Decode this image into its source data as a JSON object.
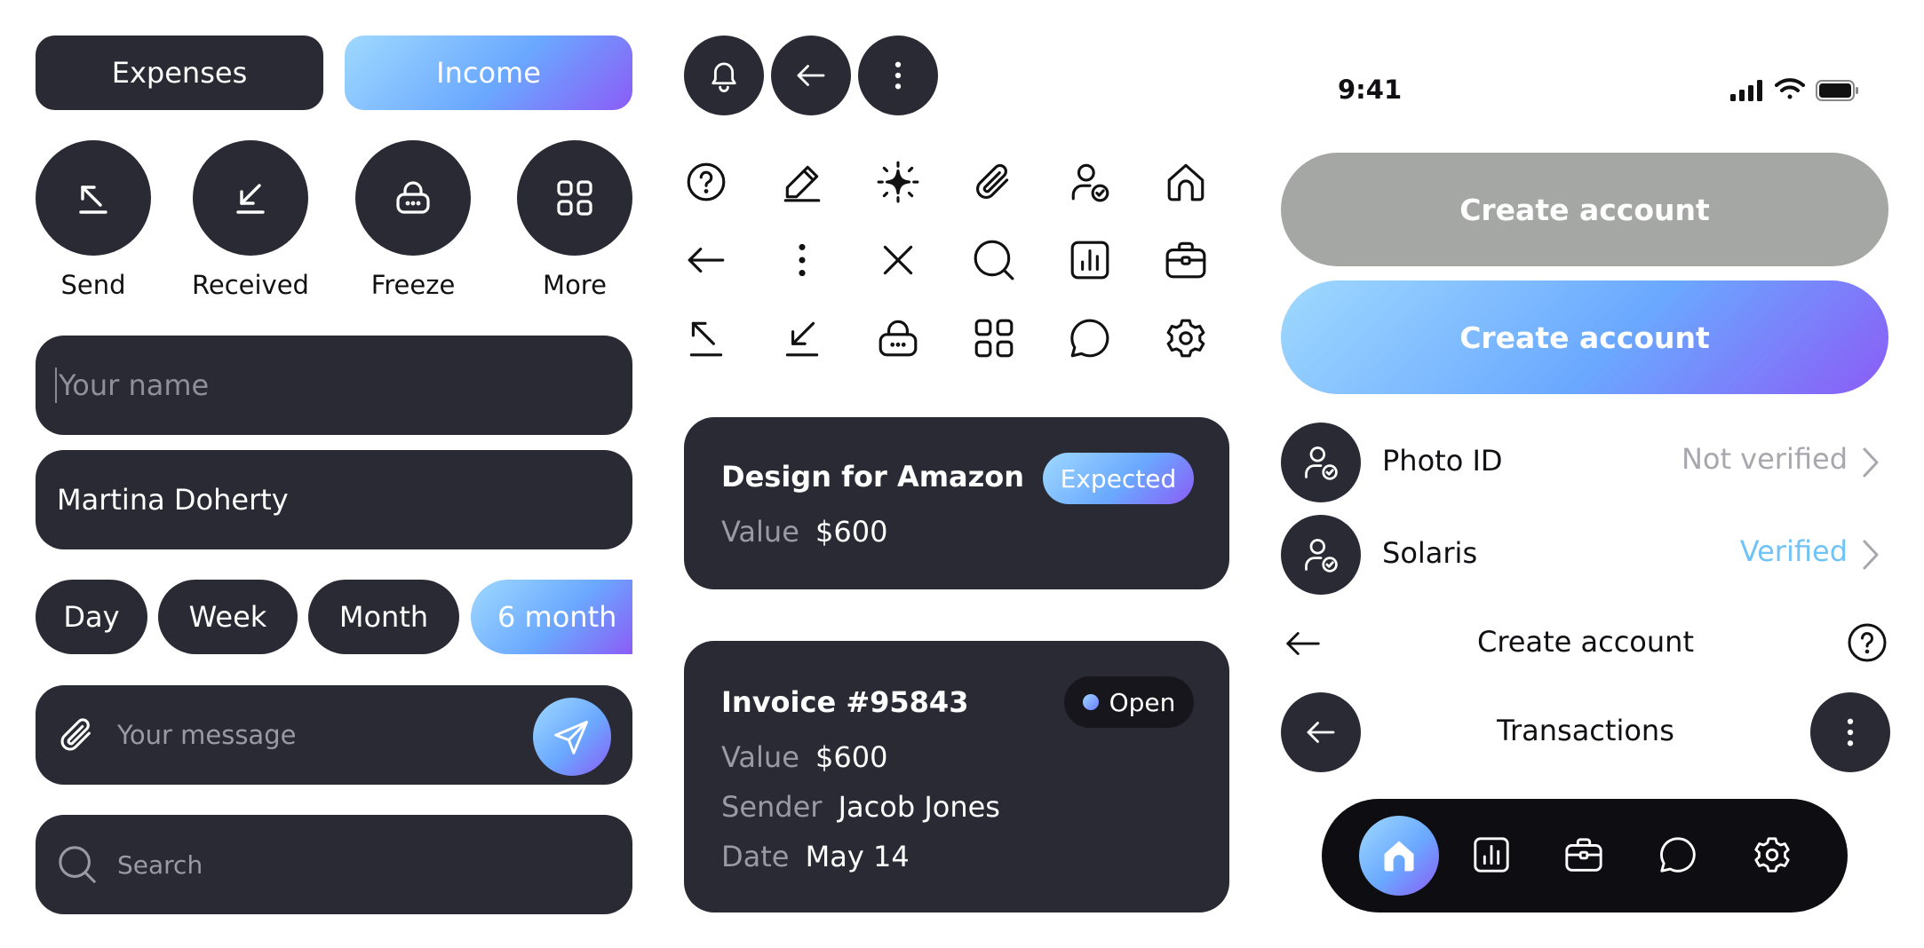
{
  "tabs": {
    "expenses": "Expenses",
    "income": "Income"
  },
  "actions": [
    {
      "label": "Send",
      "icon": "arrow-up-left-icon"
    },
    {
      "label": "Received",
      "icon": "arrow-down-left-icon"
    },
    {
      "label": "Freeze",
      "icon": "lock-icon"
    },
    {
      "label": "More",
      "icon": "grid-icon"
    }
  ],
  "inputs": {
    "name_placeholder": "Your name",
    "name_value": "Martina Doherty",
    "message_placeholder": "Your message",
    "search_placeholder": "Search"
  },
  "periods": [
    "Day",
    "Week",
    "Month",
    "6 month"
  ],
  "icon_set": [
    "help-icon",
    "pencil-icon",
    "sparkle-icon",
    "paperclip-icon",
    "user-check-icon",
    "home-icon",
    "arrow-left-icon",
    "more-vertical-icon",
    "close-icon",
    "search-icon",
    "chart-icon",
    "briefcase-icon",
    "arrow-up-left-icon",
    "arrow-down-left-icon",
    "lock-icon",
    "grid-icon",
    "chat-icon",
    "gear-icon"
  ],
  "card1": {
    "title": "Design for Amazon",
    "badge": "Expected",
    "value_label": "Value",
    "value": "$600"
  },
  "card2": {
    "title": "Invoice #95843",
    "badge": "Open",
    "value_label": "Value",
    "value": "$600",
    "sender_label": "Sender",
    "sender": "Jacob Jones",
    "date_label": "Date",
    "date": "May 14"
  },
  "status_bar": {
    "time": "9:41"
  },
  "buttons": {
    "create_disabled": "Create account",
    "create_active": "Create account"
  },
  "verify_rows": [
    {
      "title": "Photo ID",
      "status": "Not verified",
      "status_color": "#a7a7ad"
    },
    {
      "title": "Solaris",
      "status": "Verified",
      "status_color": "#6fc3f7"
    }
  ],
  "headers": {
    "create_account": "Create account",
    "transactions": "Transactions"
  },
  "bottom_nav": [
    "home-icon",
    "chart-icon",
    "briefcase-icon",
    "chat-icon",
    "gear-icon"
  ],
  "colors": {
    "dark": "#2a2a35",
    "accent_start": "#9fd9ff",
    "accent_end": "#8b5cf6",
    "verified": "#6fc3f7"
  }
}
